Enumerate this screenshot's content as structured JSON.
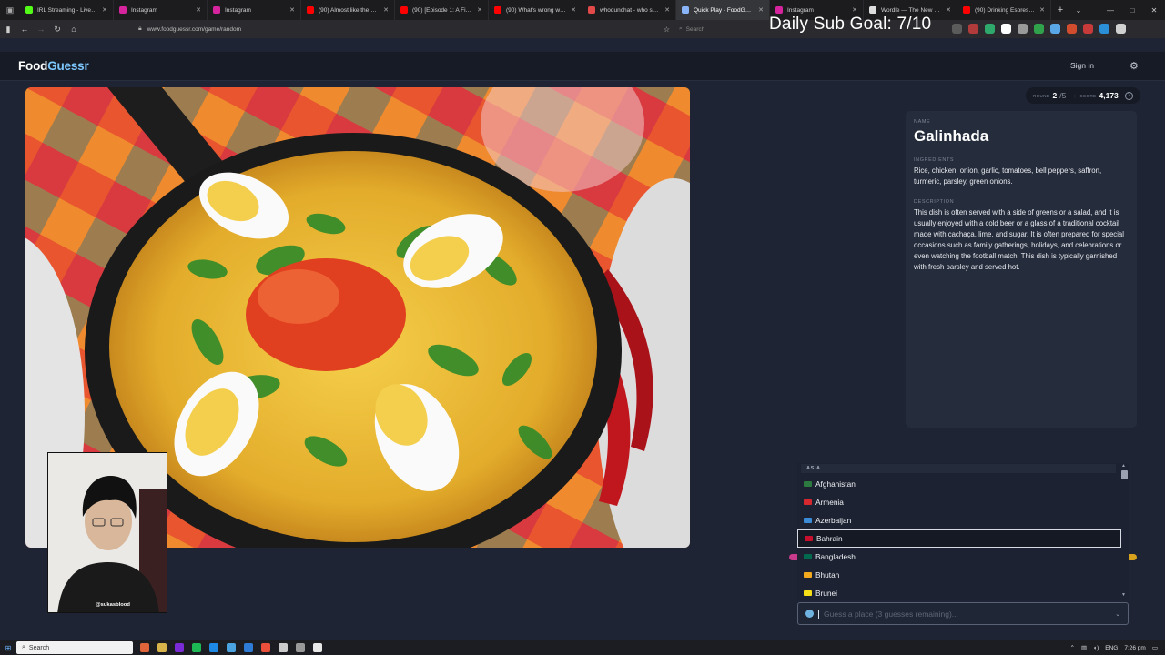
{
  "browser": {
    "tabs": [
      {
        "title": "IRL Streaming - Live Stream",
        "color": "#53fc18"
      },
      {
        "title": "Instagram",
        "color": "#d6249f"
      },
      {
        "title": "Instagram",
        "color": "#d6249f"
      },
      {
        "title": "(90) Almost like the sect lea",
        "color": "#ff0000"
      },
      {
        "title": "(90) [Episode 1: A Fighting C",
        "color": "#ff0000"
      },
      {
        "title": "(90) What's wrong with my",
        "color": "#ff0000"
      },
      {
        "title": "whodunchat - who said it in",
        "color": "#e24a4a"
      },
      {
        "title": "Quick Play - FoodGuessr",
        "color": "#8ab4f8",
        "active": true
      },
      {
        "title": "Instagram",
        "color": "#d6249f"
      },
      {
        "title": "Wordle — The New York Ti",
        "color": "#dddddd"
      },
      {
        "title": "(90) Drinking Espresso from",
        "color": "#ff0000"
      }
    ],
    "url": "www.foodguessr.com/game/random",
    "search_placeholder": "Search",
    "new_tab": "+",
    "extension_colors": [
      "#5b5b5b",
      "#b13b3b",
      "#2fa86b",
      "#ffffff",
      "#9a9a9a",
      "#31a24c",
      "#5aa7e8",
      "#d24d2e",
      "#c73a3a",
      "#2b8fd8",
      "#d0d0d0"
    ]
  },
  "stream_overlay": {
    "goal_text": "Daily Sub Goal: 7/10",
    "webcam_handle": "@sukasblood"
  },
  "site": {
    "logo_part1": "Food",
    "logo_part2": "Guessr",
    "signin_label": "Sign in"
  },
  "score": {
    "round_label": "ROUND",
    "round_value": "2",
    "round_total": "/5",
    "score_label": "SCORE",
    "score_value": "4,173",
    "help_glyph": "?"
  },
  "dish": {
    "name_header": "NAME",
    "name": "Galinhada",
    "ingredients_header": "INGREDIENTS",
    "ingredients": "Rice, chicken, onion, garlic, tomatoes, bell peppers, saffron, turmeric, parsley, green onions.",
    "description_header": "DESCRIPTION",
    "description": "This dish is often served with a side of greens or a salad, and it is usually enjoyed with a cold beer or a glass of a traditional cocktail made with cachaça, lime, and sugar. It is often prepared for special occasions such as family gatherings, holidays, and celebrations or even watching the football match. This dish is typically garnished with fresh parsley and served hot."
  },
  "country_list": {
    "region": "ASIA",
    "items": [
      {
        "name": "Afghanistan",
        "flag": "#2c7a3f"
      },
      {
        "name": "Armenia",
        "flag": "#d5282f"
      },
      {
        "name": "Azerbaijan",
        "flag": "#3b8bd6"
      },
      {
        "name": "Bahrain",
        "flag": "#c8102e",
        "selected": true
      },
      {
        "name": "Bangladesh",
        "flag": "#006a4e"
      },
      {
        "name": "Bhutan",
        "flag": "#f2a91e"
      },
      {
        "name": "Brunei",
        "flag": "#f7e017"
      }
    ]
  },
  "guess_input": {
    "placeholder": "Guess a place (3 guesses remaining)..."
  },
  "taskbar": {
    "search_label": "Search",
    "app_colors": [
      "#e0653a",
      "#d9b44a",
      "#7a2bd6",
      "#1db954",
      "#1e88e5",
      "#4aa3df",
      "#2e7bd6",
      "#e94f3a",
      "#cccccc",
      "#999999",
      "#e8e8e8"
    ],
    "lang": "ENG",
    "time": "7:26 pm"
  }
}
